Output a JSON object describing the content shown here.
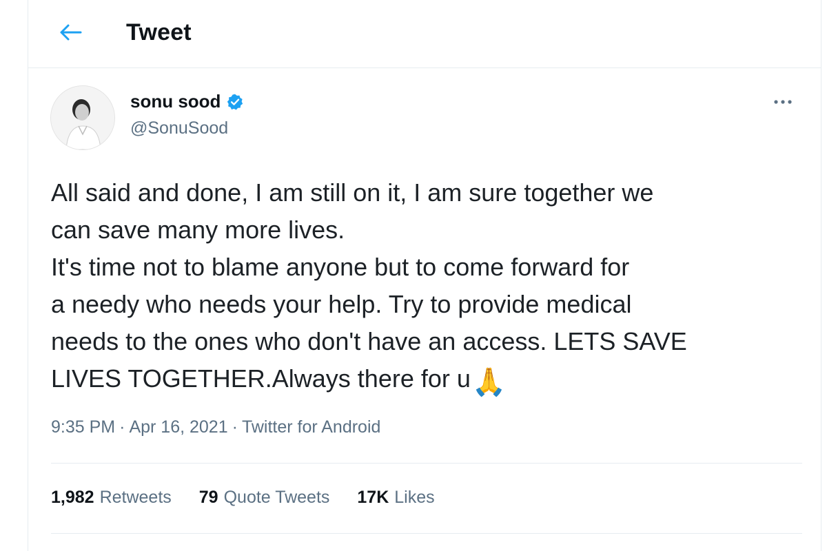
{
  "header": {
    "title": "Tweet",
    "back_icon": "arrow-left-icon"
  },
  "tweet": {
    "author": {
      "name": "sonu sood",
      "handle": "@SonuSood",
      "verified_icon": "verified-badge-icon"
    },
    "text": "All said and done, I am still on it, I am sure together we\ncan save many more lives.\nIt's time not to blame anyone but to come forward for\na needy who needs your help. Try to provide medical\nneeds to the ones who don't have an access. LETS SAVE\nLIVES TOGETHER.Always there for u",
    "emoji": "🙏",
    "meta": {
      "time": "9:35 PM",
      "date": "Apr 16, 2021",
      "source": "Twitter for Android",
      "separator": "·"
    },
    "stats": {
      "retweets_count": "1,982",
      "retweets_label": "Retweets",
      "quotes_count": "79",
      "quotes_label": "Quote Tweets",
      "likes_count": "17K",
      "likes_label": "Likes"
    }
  },
  "colors": {
    "accent": "#1da1f2",
    "secondary_text": "#5b7083",
    "divider": "#e6ecf0"
  }
}
